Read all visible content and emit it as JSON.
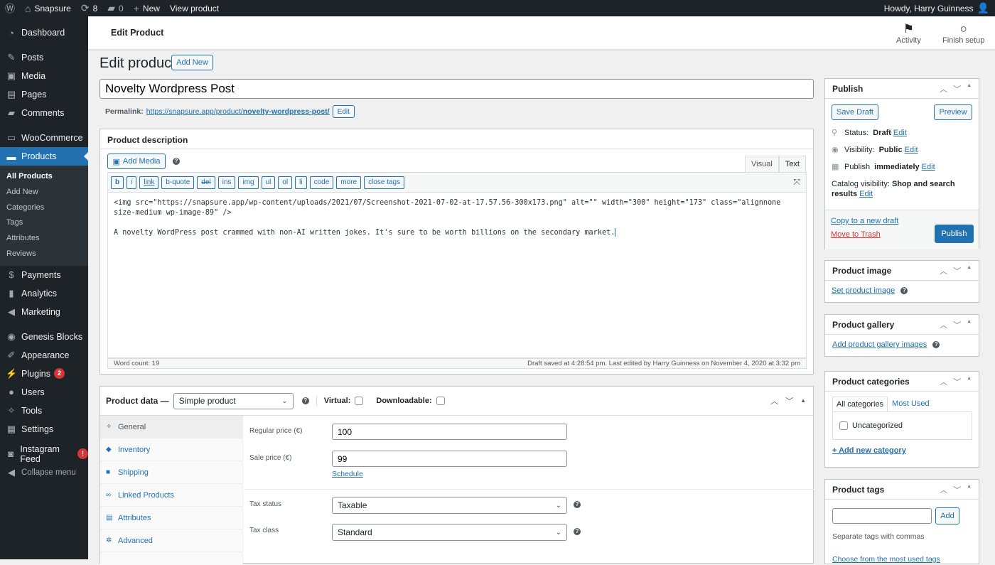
{
  "adminbar": {
    "site_name": "Snapsure",
    "updates_count": "8",
    "comments_count": "0",
    "new_label": "New",
    "view_label": "View product",
    "howdy": "Howdy, Harry Guinness"
  },
  "sidebar": {
    "items": [
      {
        "label": "Dashboard",
        "icon": "dashboard-icon"
      },
      {
        "label": "Posts",
        "icon": "pin-icon"
      },
      {
        "label": "Media",
        "icon": "media-icon"
      },
      {
        "label": "Pages",
        "icon": "pages-icon"
      },
      {
        "label": "Comments",
        "icon": "comment-icon"
      },
      {
        "label": "WooCommerce",
        "icon": "woo-icon"
      },
      {
        "label": "Products",
        "icon": "archive-icon"
      },
      {
        "label": "Payments",
        "icon": "dollar-icon"
      },
      {
        "label": "Analytics",
        "icon": "bar-chart-icon"
      },
      {
        "label": "Marketing",
        "icon": "megaphone-icon"
      },
      {
        "label": "Genesis Blocks",
        "icon": "genesis-icon"
      },
      {
        "label": "Appearance",
        "icon": "brush-icon"
      },
      {
        "label": "Plugins",
        "icon": "plug-icon",
        "badge": "2"
      },
      {
        "label": "Users",
        "icon": "user-icon"
      },
      {
        "label": "Tools",
        "icon": "wrench-icon"
      },
      {
        "label": "Settings",
        "icon": "sliders-icon"
      },
      {
        "label": "Instagram Feed",
        "icon": "camera-icon",
        "badge": "!"
      }
    ],
    "submenu": [
      "All Products",
      "Add New",
      "Categories",
      "Tags",
      "Attributes",
      "Reviews"
    ],
    "collapse_label": "Collapse menu"
  },
  "header": {
    "title": "Edit Product",
    "activity_label": "Activity",
    "finish_setup_label": "Finish setup"
  },
  "page": {
    "title": "Edit product",
    "add_new_label": "Add New",
    "product_title": "Novelty Wordpress Post",
    "permalink_label": "Permalink:",
    "permalink_base": "https://snapsure.app/product/",
    "permalink_slug": "novelty-wordpress-post/",
    "permalink_edit": "Edit"
  },
  "description": {
    "heading": "Product description",
    "add_media_label": "Add Media",
    "tab_visual": "Visual",
    "tab_text": "Text",
    "quicktags": [
      "b",
      "i",
      "link",
      "b-quote",
      "del",
      "ins",
      "img",
      "ul",
      "ol",
      "li",
      "code",
      "more",
      "close tags"
    ],
    "content_line1": "<img src=\"https://snapsure.app/wp-content/uploads/2021/07/Screenshot-2021-07-02-at-17.57.56-300x173.png\" alt=\"\" width=\"300\" height=\"173\" class=\"alignnone size-medium wp-image-89\" />",
    "content_line2": "A novelty WordPress post crammed with non-AI written jokes. It's sure to be worth billions on the secondary market.",
    "word_count": "Word count: 19",
    "draft_status": "Draft saved at 4:28:54 pm. Last edited by Harry Guinness on November 4, 2020 at 3:32 pm"
  },
  "product_data": {
    "heading": "Product data —",
    "type_selected": "Simple product",
    "virtual_label": "Virtual:",
    "virtual_checked": false,
    "downloadable_label": "Downloadable:",
    "downloadable_checked": false,
    "tabs": [
      {
        "label": "General",
        "icon": "wrench-icon"
      },
      {
        "label": "Inventory",
        "icon": "tag-icon"
      },
      {
        "label": "Shipping",
        "icon": "truck-icon"
      },
      {
        "label": "Linked Products",
        "icon": "link-icon"
      },
      {
        "label": "Attributes",
        "icon": "list-icon"
      },
      {
        "label": "Advanced",
        "icon": "gear-icon"
      }
    ],
    "regular_price_label": "Regular price (€)",
    "regular_price": "100",
    "sale_price_label": "Sale price (€)",
    "sale_price": "99",
    "schedule_label": "Schedule",
    "tax_status_label": "Tax status",
    "tax_status": "Taxable",
    "tax_class_label": "Tax class",
    "tax_class": "Standard"
  },
  "publish": {
    "heading": "Publish",
    "save_draft": "Save Draft",
    "preview": "Preview",
    "status_label": "Status:",
    "status_value": "Draft",
    "visibility_label": "Visibility:",
    "visibility_value": "Public",
    "publish_label": "Publish",
    "publish_value": "immediately",
    "catalog_label": "Catalog visibility:",
    "catalog_value": "Shop and search results",
    "edit": "Edit",
    "copy_draft": "Copy to a new draft",
    "trash": "Move to Trash",
    "publish_button": "Publish"
  },
  "product_image": {
    "heading": "Product image",
    "link": "Set product image"
  },
  "product_gallery": {
    "heading": "Product gallery",
    "link": "Add product gallery images"
  },
  "categories": {
    "heading": "Product categories",
    "tab_all": "All categories",
    "tab_most_used": "Most Used",
    "items": [
      {
        "label": "Uncategorized",
        "checked": false
      }
    ],
    "add_new": "+ Add new category"
  },
  "tags": {
    "heading": "Product tags",
    "input_value": "",
    "add_button": "Add",
    "hint": "Separate tags with commas",
    "choose_link": "Choose from the most used tags"
  }
}
